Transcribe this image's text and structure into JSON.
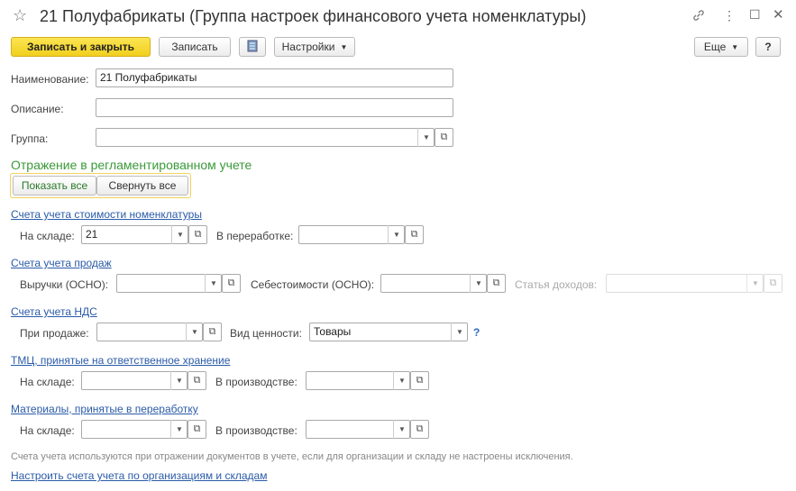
{
  "window": {
    "title": "21 Полуфабрикаты (Группа настроек финансового учета номенклатуры)",
    "icons": [
      "star-icon",
      "link-icon",
      "more-icon",
      "maximize-icon",
      "close-icon"
    ]
  },
  "toolbar": {
    "save_close_label": "Записать и закрыть",
    "save_label": "Записать",
    "settings_label": "Настройки",
    "more_label": "Еще",
    "help_label": "?"
  },
  "form": {
    "name_label": "Наименование:",
    "name_value": "21 Полуфабрикаты",
    "description_label": "Описание:",
    "description_value": "",
    "group_label": "Группа:",
    "group_value": ""
  },
  "reg": {
    "title": "Отражение в регламентированном учете",
    "show_all": "Показать все",
    "collapse_all": "Свернуть все"
  },
  "sections": {
    "cost": {
      "title": "Счета учета стоимости номенклатуры",
      "warehouse_label": "На складе:",
      "warehouse_value": "21",
      "processing_label": "В переработке:",
      "processing_value": ""
    },
    "sales": {
      "title": "Счета учета продаж",
      "revenue_label": "Выручки (ОСНО):",
      "revenue_value": "",
      "cogs_label": "Себестоимости (ОСНО):",
      "cogs_value": "",
      "income_label": "Статья доходов:",
      "income_value": ""
    },
    "vat": {
      "title": "Счета учета НДС",
      "sale_label": "При продаже:",
      "sale_value": "",
      "value_type_label": "Вид ценности:",
      "value_type_value": "Товары",
      "help": "?"
    },
    "custody": {
      "title": "ТМЦ, принятые на ответственное хранение",
      "warehouse_label": "На складе:",
      "warehouse_value": "",
      "production_label": "В производстве:",
      "production_value": ""
    },
    "materials": {
      "title": "Материалы, принятые в переработку",
      "warehouse_label": "На складе:",
      "warehouse_value": "",
      "production_label": "В производстве:",
      "production_value": ""
    }
  },
  "footer": {
    "note": "Счета учета используются при отражении документов в учете, если для организации и складу не настроены исключения.",
    "link": "Настроить счета учета по организациям и складам"
  }
}
